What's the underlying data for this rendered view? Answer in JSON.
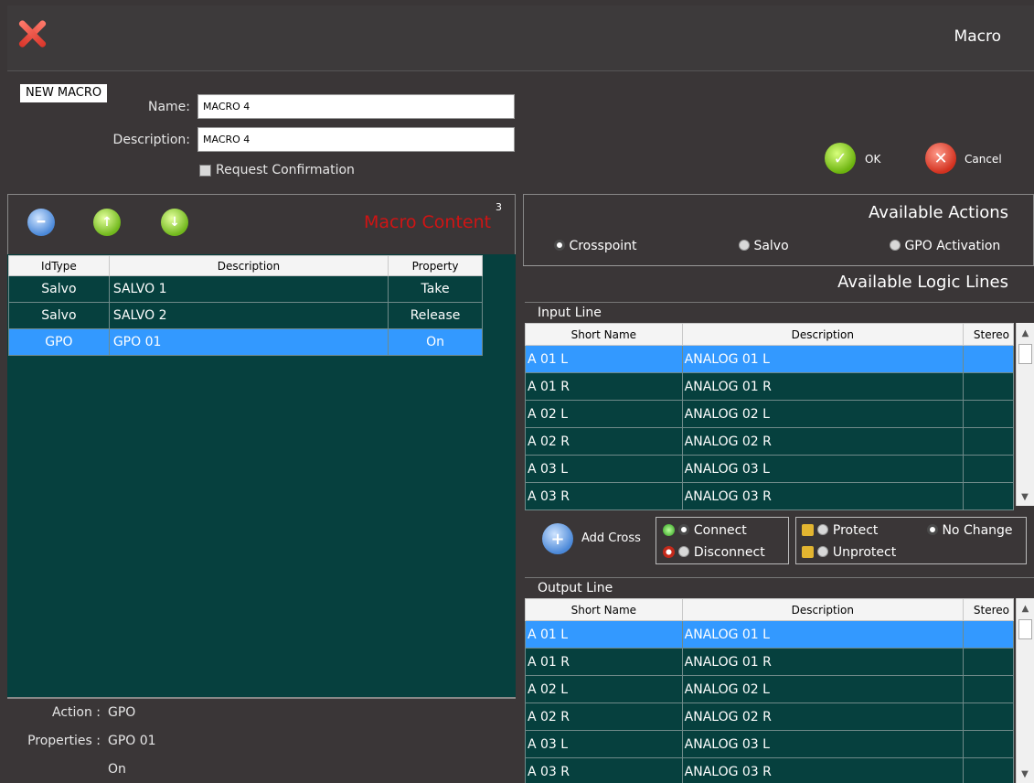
{
  "window": {
    "title": "Macro"
  },
  "macro": {
    "badge": "NEW MACRO",
    "name_label": "Name:",
    "name_value": "MACRO 4",
    "description_label": "Description:",
    "description_value": "MACRO 4",
    "request_confirmation": "Request Confirmation",
    "ok_label": "OK",
    "cancel_label": "Cancel"
  },
  "content": {
    "title": "Macro Content",
    "count": "3",
    "headers": [
      "IdType",
      "Description",
      "Property"
    ],
    "rows": [
      {
        "idtype": "Salvo",
        "description": "SALVO 1",
        "property": "Take"
      },
      {
        "idtype": "Salvo",
        "description": "SALVO 2",
        "property": "Release"
      },
      {
        "idtype": "GPO",
        "description": "GPO 01",
        "property": "On"
      }
    ],
    "selected_row": 2
  },
  "status": {
    "action_label": "Action :",
    "action_value": "GPO",
    "properties_label": "Properties :",
    "properties_value1": "GPO 01",
    "properties_value2": "On"
  },
  "actions": {
    "title": "Available Actions",
    "options": [
      "Crosspoint",
      "Salvo",
      "GPO Activation"
    ],
    "selected": "Crosspoint"
  },
  "logic": {
    "title": "Available Logic Lines",
    "input_title": "Input Line",
    "output_title": "Output Line",
    "headers": [
      "Short Name",
      "Description",
      "Stereo"
    ],
    "input_rows": [
      {
        "short": "A 01 L",
        "desc": "ANALOG 01 L"
      },
      {
        "short": "A 01 R",
        "desc": "ANALOG 01 R"
      },
      {
        "short": "A 02 L",
        "desc": "ANALOG 02 L"
      },
      {
        "short": "A 02 R",
        "desc": "ANALOG 02 R"
      },
      {
        "short": "A 03 L",
        "desc": "ANALOG 03 L"
      },
      {
        "short": "A 03 R",
        "desc": "ANALOG 03 R"
      }
    ],
    "output_rows": [
      {
        "short": "A 01 L",
        "desc": "ANALOG 01 L"
      },
      {
        "short": "A 01 R",
        "desc": "ANALOG 01 R"
      },
      {
        "short": "A 02 L",
        "desc": "ANALOG 02 L"
      },
      {
        "short": "A 02 R",
        "desc": "ANALOG 02 R"
      },
      {
        "short": "A 03 L",
        "desc": "ANALOG 03 L"
      },
      {
        "short": "A 03 R",
        "desc": "ANALOG 03 R"
      }
    ]
  },
  "cross": {
    "add_label": "Add Cross",
    "connect": "Connect",
    "disconnect": "Disconnect",
    "protect": "Protect",
    "unprotect": "Unprotect",
    "no_change": "No Change"
  },
  "colors": {
    "grid_bg": "#06403e",
    "selection": "#3399ff",
    "frame": "#3a3637",
    "macro_title": "#d01414"
  }
}
